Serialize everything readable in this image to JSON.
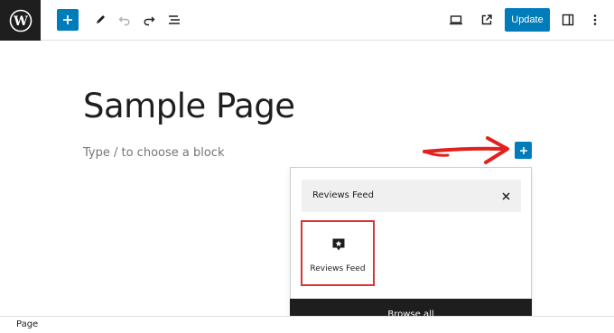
{
  "toolbar": {
    "update_label": "Update",
    "icons": [
      "wordpress-logo",
      "plus",
      "pencil",
      "undo",
      "redo",
      "list-view",
      "desktop-preview",
      "external-link",
      "sidebar-toggle",
      "more-vertical"
    ]
  },
  "editor": {
    "title": "Sample Page",
    "placeholder": "Type / to choose a block"
  },
  "inserter": {
    "search_value": "Reviews Feed",
    "result": {
      "label": "Reviews Feed",
      "icon": "review-star-bubble"
    },
    "browse_all_label": "Browse all"
  },
  "footer": {
    "breadcrumb": "Page"
  },
  "colors": {
    "accent": "#007cba",
    "highlight": "#d63638",
    "annotation": "#e0211d",
    "dark": "#1e1e1e"
  }
}
